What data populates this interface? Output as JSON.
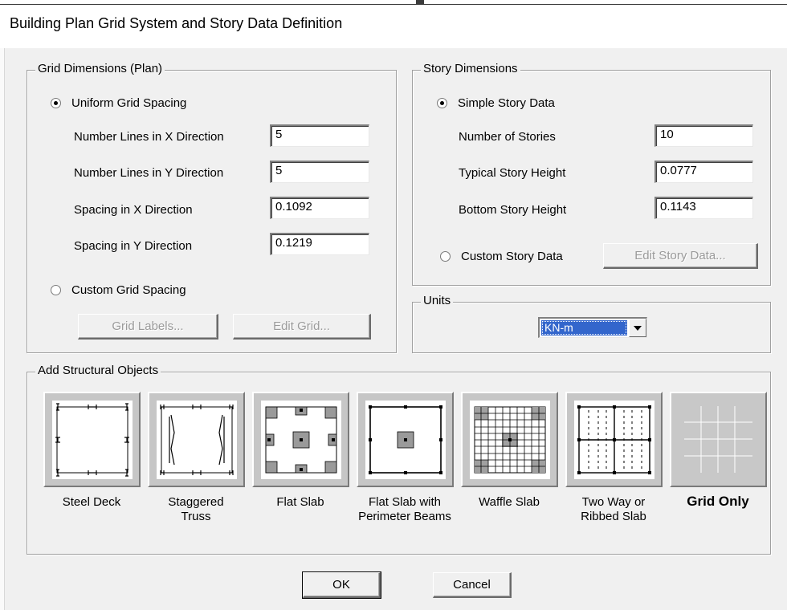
{
  "window": {
    "title": "Building Plan Grid System and Story Data Definition"
  },
  "grid_dimensions": {
    "legend": "Grid Dimensions (Plan)",
    "uniform_label": "Uniform Grid Spacing",
    "uniform_selected": true,
    "fields": [
      {
        "label": "Number Lines in X Direction",
        "value": "5"
      },
      {
        "label": "Number Lines in Y Direction",
        "value": "5"
      },
      {
        "label": "Spacing in X Direction",
        "value": "0.1092"
      },
      {
        "label": "Spacing in Y Direction",
        "value": "0.1219"
      }
    ],
    "custom_label": "Custom Grid Spacing",
    "grid_labels_button": "Grid Labels...",
    "edit_grid_button": "Edit Grid..."
  },
  "story_dimensions": {
    "legend": "Story Dimensions",
    "simple_label": "Simple Story Data",
    "simple_selected": true,
    "fields": [
      {
        "label": "Number of Stories",
        "value": "10"
      },
      {
        "label": "Typical Story Height",
        "value": "0.0777"
      },
      {
        "label": "Bottom Story Height",
        "value": "0.1143"
      }
    ],
    "custom_label": "Custom Story Data",
    "edit_story_button": "Edit Story Data..."
  },
  "units": {
    "legend": "Units",
    "selected": "KN-m"
  },
  "structural_objects": {
    "legend": "Add Structural Objects",
    "items": [
      {
        "label_line1": "Steel Deck",
        "label_line2": "",
        "icon": "steel-deck-icon"
      },
      {
        "label_line1": "Staggered",
        "label_line2": "Truss",
        "icon": "staggered-truss-icon"
      },
      {
        "label_line1": "Flat Slab",
        "label_line2": "",
        "icon": "flat-slab-icon"
      },
      {
        "label_line1": "Flat Slab with",
        "label_line2": "Perimeter Beams",
        "icon": "flat-slab-perimeter-beams-icon"
      },
      {
        "label_line1": "Waffle Slab",
        "label_line2": "",
        "icon": "waffle-slab-icon"
      },
      {
        "label_line1": "Two Way or",
        "label_line2": "Ribbed Slab",
        "icon": "two-way-ribbed-slab-icon"
      },
      {
        "label_line1": "Grid Only",
        "label_line2": "",
        "icon": "grid-only-icon",
        "selected": true
      }
    ]
  },
  "footer": {
    "ok_label": "OK",
    "cancel_label": "Cancel"
  }
}
